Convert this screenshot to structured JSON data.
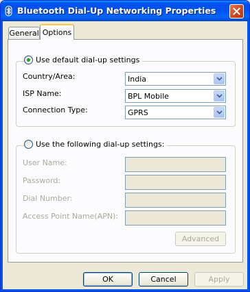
{
  "window": {
    "title": "Bluetooth Dial-Up Networking Properties"
  },
  "tabs": [
    {
      "label": "General",
      "selected": false
    },
    {
      "label": "Options",
      "selected": true
    }
  ],
  "default_settings": {
    "radio_label": "Use default dial-up settings",
    "selected": true,
    "country_label": "Country/Area:",
    "country_value": "India",
    "isp_label": "ISP Name:",
    "isp_value": "BPL Mobile",
    "connection_label": "Connection Type:",
    "connection_value": "GPRS"
  },
  "custom_settings": {
    "radio_label": "Use the following dial-up settings:",
    "selected": false,
    "user_name_label": "User Name:",
    "user_name_value": "",
    "password_label": "Password:",
    "password_value": "",
    "dial_number_label": "Dial Number:",
    "dial_number_value": "",
    "apn_label": "Access Point Name(APN):",
    "apn_value": "",
    "advanced_label": "Advanced"
  },
  "buttons": {
    "ok": "OK",
    "cancel": "Cancel",
    "apply": "Apply"
  },
  "colors": {
    "title_bar": "#0054e3",
    "dialog_face": "#ece9d8",
    "close_button": "#d2461a",
    "radio_dot": "#21a121"
  }
}
